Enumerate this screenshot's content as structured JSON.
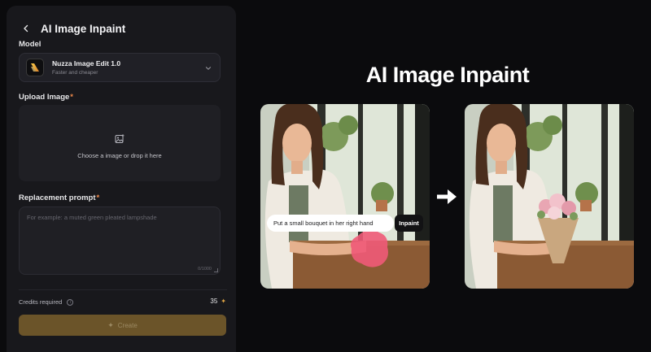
{
  "header": {
    "title": "AI Image Inpaint",
    "back_icon": "chevron-left-icon"
  },
  "model": {
    "label": "Model",
    "name": "Nuzza Image Edit 1.0",
    "subtitle": "Faster and cheaper",
    "icon": "model-logo-icon"
  },
  "upload": {
    "label": "Upload Image",
    "required_mark": "*",
    "hint": "Choose a image or drop it here",
    "icon": "image-upload-icon"
  },
  "prompt": {
    "label": "Replacement prompt",
    "required_mark": "*",
    "placeholder": "For example: a muted green pleated lampshade",
    "counter": "0/1000"
  },
  "credits": {
    "label": "Credits required",
    "value": "35"
  },
  "create_button": {
    "label": "Create"
  },
  "demo": {
    "title": "AI Image Inpaint",
    "prompt_example": "Put a small bouquet in her right hand",
    "inpaint_button": "Inpaint"
  },
  "colors": {
    "accent": "#e0a444",
    "create_bg": "#6b5429",
    "mask": "#f05a78",
    "panel": "#18181c"
  }
}
